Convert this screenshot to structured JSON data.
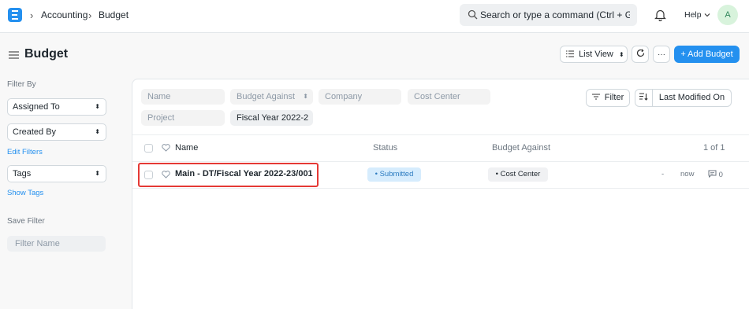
{
  "navbar": {
    "breadcrumbs": [
      "Accounting",
      "Budget"
    ],
    "search_placeholder": "Search or type a command (Ctrl + G)",
    "help_label": "Help",
    "avatar_initial": "A"
  },
  "header": {
    "title": "Budget",
    "list_view_label": "List View",
    "add_button_label": "+ Add Budget"
  },
  "sidebar": {
    "filter_by_heading": "Filter By",
    "assigned_to_label": "Assigned To",
    "created_by_label": "Created By",
    "edit_filters_label": "Edit Filters",
    "tags_label": "Tags",
    "show_tags_label": "Show Tags",
    "save_filter_heading": "Save Filter",
    "filter_name_placeholder": "Filter Name"
  },
  "filters": {
    "name_placeholder": "Name",
    "budget_against_label": "Budget Against",
    "company_placeholder": "Company",
    "cost_center_placeholder": "Cost Center",
    "project_placeholder": "Project",
    "fiscal_year_value": "Fiscal Year 2022-2",
    "filter_button_label": "Filter",
    "sort_label": "Last Modified On"
  },
  "list": {
    "columns": [
      "Name",
      "Status",
      "Budget Against"
    ],
    "count_label": "1 of 1",
    "rows": [
      {
        "name": "Main - DT/Fiscal Year 2022-23/001",
        "status": "Submitted",
        "budget_against": "Cost Center",
        "dash": "-",
        "modified": "now",
        "comments": "0"
      }
    ]
  },
  "colors": {
    "primary": "#2490ef",
    "status_bg": "#d6ecfd",
    "highlight": "#e53935"
  }
}
